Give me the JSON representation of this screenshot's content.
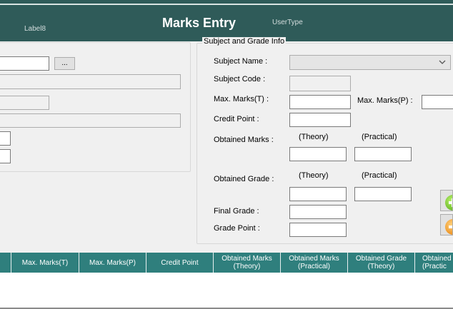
{
  "header": {
    "title": "Marks Entry",
    "label8": "Label8",
    "usertype": "UserType"
  },
  "left_panel": {
    "browse_button": "..."
  },
  "subject_group": {
    "caption": "Subject and Grade Info",
    "subject_name_label": "Subject Name :",
    "subject_code_label": "Subject Code :",
    "max_marks_t_label": "Max. Marks(T) :",
    "max_marks_p_label": "Max. Marks(P) :",
    "credit_point_label": "Credit Point :",
    "obtained_marks_label": "Obtained Marks :",
    "obtained_grade_label": "Obtained Grade :",
    "theory_label": "(Theory)",
    "practical_label": "(Practical)",
    "final_grade_label": "Final Grade :",
    "grade_point_label": "Grade Point :"
  },
  "grid": {
    "columns": [
      {
        "line1": "",
        "line2": ""
      },
      {
        "line1": "Max. Marks(T)",
        "line2": ""
      },
      {
        "line1": "Max. Marks(P)",
        "line2": ""
      },
      {
        "line1": "Credit Point",
        "line2": ""
      },
      {
        "line1": "Obtained Marks",
        "line2": "(Theory)"
      },
      {
        "line1": "Obtained Marks",
        "line2": "(Practical)"
      },
      {
        "line1": "Obtained Grade",
        "line2": "(Theory)"
      },
      {
        "line1": "Obtained",
        "line2": "(Practic"
      }
    ]
  },
  "colors": {
    "header_bg": "#2f5b59",
    "grid_header_bg": "#2f7f7d",
    "add_icon": "#4fa612",
    "remove_icon": "#e57a00"
  },
  "icons": {
    "dropdown": "chevron-down-icon",
    "add": "add-circle-icon",
    "remove": "remove-circle-icon"
  }
}
